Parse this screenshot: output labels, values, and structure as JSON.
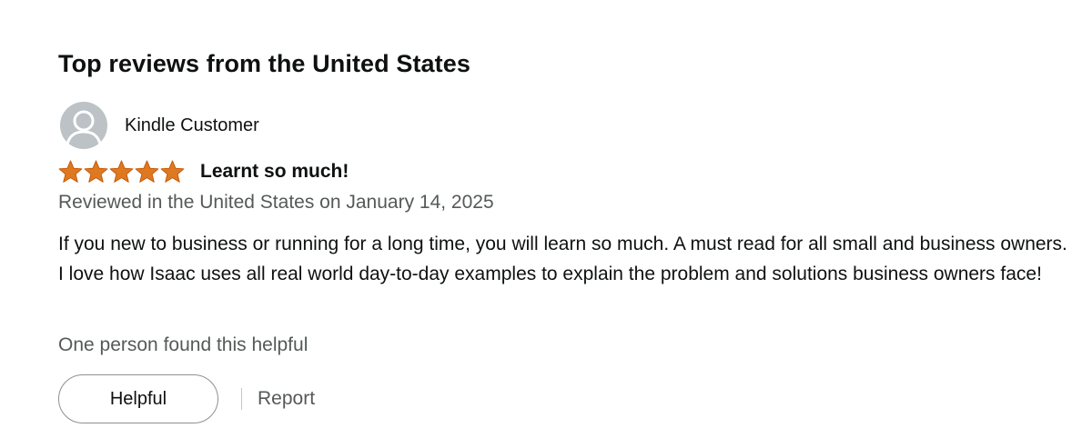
{
  "section": {
    "title": "Top reviews from the United States"
  },
  "review": {
    "profile_name": "Kindle Customer",
    "rating": 5,
    "rating_max": 5,
    "title": "Learnt so much!",
    "date": "Reviewed in the United States on January 14, 2025",
    "body": "If you new to business or running for a long time, you will learn so much. A must read for all small and business owners. I love how Isaac uses all real world day-to-day examples to explain the problem and solutions business owners face!",
    "helpful_count": "One person found this helpful"
  },
  "actions": {
    "helpful_label": "Helpful",
    "report_label": "Report"
  },
  "colors": {
    "star": "#de7921",
    "secondary_text": "#565959",
    "avatar_bg": "#bcc2c5"
  },
  "icons": {
    "avatar": "person-icon",
    "rating": "star-icon"
  }
}
